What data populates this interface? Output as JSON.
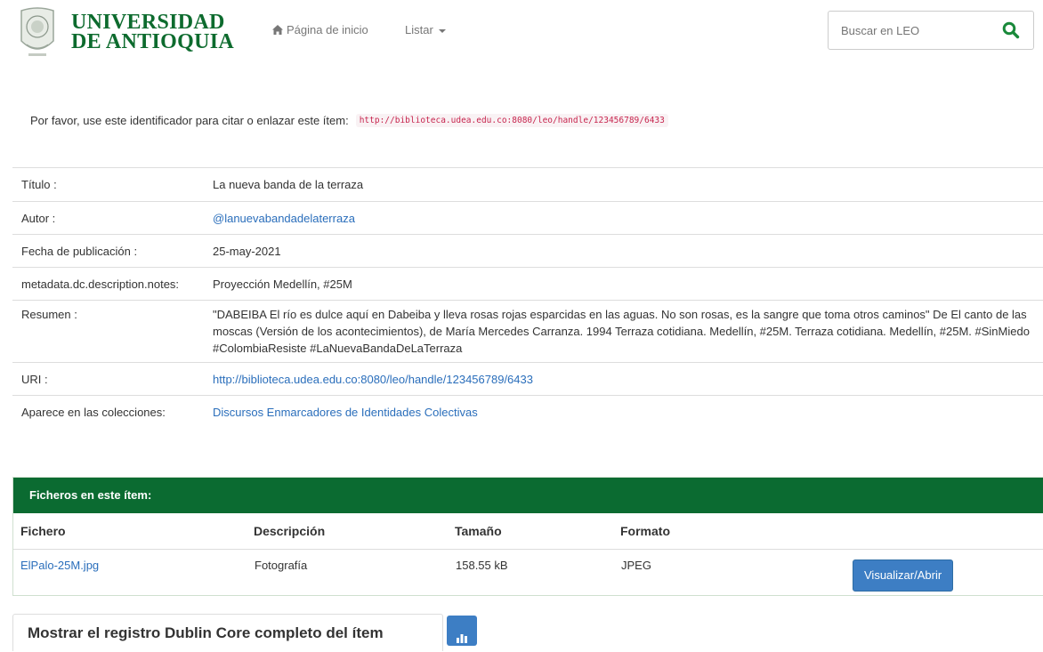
{
  "header": {
    "logo_text": [
      "UNIVERSIDAD",
      "DE ANTIOQUIA"
    ],
    "nav": {
      "home": "Página de inicio",
      "list": "Listar"
    },
    "search_placeholder": "Buscar en LEO"
  },
  "cite": {
    "text": "Por favor, use este identificador para citar o enlazar este ítem:",
    "url": "http://biblioteca.udea.edu.co:8080/leo/handle/123456789/6433"
  },
  "metadata": {
    "title_label": "Título :",
    "title_value": "La nueva banda de la terraza",
    "author_label": "Autor :",
    "author_value": "@lanuevabandadelaterraza",
    "date_label": "Fecha de publicación :",
    "date_value": "25-may-2021",
    "notes_label": "metadata.dc.description.notes:",
    "notes_value": "Proyección Medellín, #25M",
    "abstract_label": "Resumen :",
    "abstract_value": "\"DABEIBA El río es dulce aquí en Dabeiba y lleva rosas rojas esparcidas en las aguas. No son rosas, es la sangre que toma otros caminos\" De El canto de las moscas (Versión de los acontecimientos), de María Mercedes Carranza. 1994 Terraza cotidiana. Medellín, #25M. Terraza cotidiana. Medellín, #25M. #SinMiedo #ColombiaResiste #LaNuevaBandaDeLaTerraza",
    "uri_label": "URI :",
    "uri_value": "http://biblioteca.udea.edu.co:8080/leo/handle/123456789/6433",
    "collections_label": "Aparece en las colecciones:",
    "collections_value": "Discursos Enmarcadores de Identidades Colectivas"
  },
  "files": {
    "heading": "Ficheros en este ítem:",
    "columns": {
      "file": "Fichero",
      "description": "Descripción",
      "size": "Tamaño",
      "format": "Formato"
    },
    "row": {
      "file": "ElPalo-25M.jpg",
      "description": "Fotografía",
      "size": "158.55 kB",
      "format": "JPEG",
      "action": "Visualizar/Abrir"
    }
  },
  "dublin_core_label": "Mostrar el registro Dublin Core completo del ítem",
  "colors": {
    "brand_green": "#0b6b31",
    "link_blue": "#2a6ebb",
    "button_blue": "#3d7ec4",
    "code_red": "#c7254e"
  }
}
